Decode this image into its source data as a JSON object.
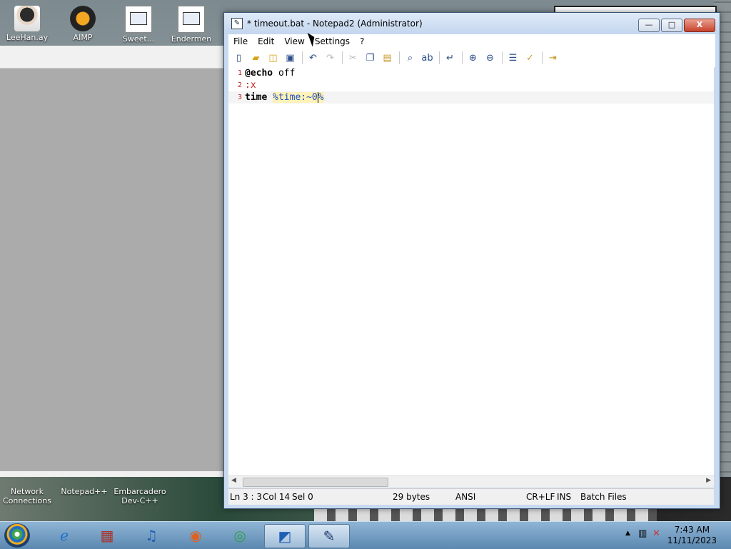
{
  "desktop": {
    "icons": [
      {
        "label": "LeeHan.ay"
      },
      {
        "label": "AIMP"
      },
      {
        "label": "Sweet..."
      },
      {
        "label": "Endermen"
      }
    ],
    "bottom_icons": [
      {
        "label": "Network Connections"
      },
      {
        "label": "Notepad++"
      },
      {
        "label": "Embarcadero Dev-C++"
      }
    ]
  },
  "window": {
    "title": "* timeout.bat - Notepad2 (Administrator)",
    "controls": {
      "minimize": "—",
      "maximize": "□",
      "close": "X"
    }
  },
  "menu": [
    "File",
    "Edit",
    "View",
    "Settings",
    "?"
  ],
  "editor": {
    "lines": [
      {
        "number": "1",
        "kw": "@echo",
        "rest": " off"
      },
      {
        "number": "2",
        "label": ":x"
      },
      {
        "number": "3",
        "kw": "time",
        "space": " ",
        "var_before": "%time:~0",
        "var_after": "%"
      }
    ]
  },
  "status": {
    "position": "Ln 3 : 3",
    "col": "Col 14",
    "sel": "Sel 0",
    "size": "29 bytes",
    "encoding": "ANSI",
    "line_endings": "CR+LF",
    "mode": "INS",
    "lexer": "Batch Files"
  },
  "taskbar": {
    "time": "7:43 AM",
    "date": "11/11/2023"
  },
  "colors": {
    "accent": "#2050c0",
    "label": "#c02020"
  }
}
